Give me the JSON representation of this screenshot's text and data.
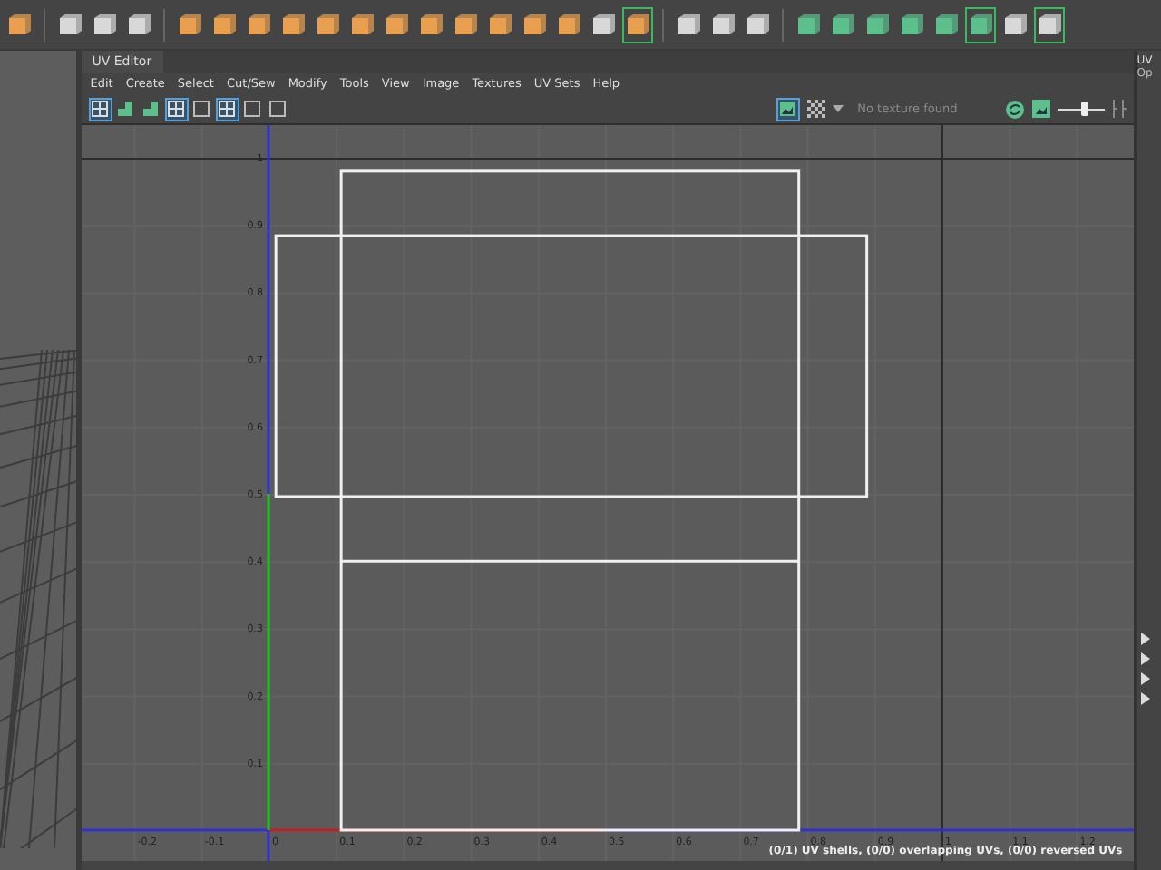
{
  "shelf": [
    {
      "kind": "orange",
      "selected": false
    },
    {
      "kind": "white",
      "selected": false
    },
    {
      "kind": "white",
      "selected": false
    },
    {
      "kind": "white",
      "selected": false
    },
    {
      "kind": "orange",
      "selected": false
    },
    {
      "kind": "orange",
      "selected": false
    },
    {
      "kind": "orange",
      "selected": false
    },
    {
      "kind": "orange",
      "selected": false
    },
    {
      "kind": "orange",
      "selected": false
    },
    {
      "kind": "orange",
      "selected": false
    },
    {
      "kind": "orange",
      "selected": false
    },
    {
      "kind": "orange",
      "selected": false
    },
    {
      "kind": "orange",
      "selected": false
    },
    {
      "kind": "orange",
      "selected": false
    },
    {
      "kind": "orange",
      "selected": false
    },
    {
      "kind": "orange",
      "selected": false
    },
    {
      "kind": "white",
      "selected": false
    },
    {
      "kind": "orange",
      "selected": true
    },
    {
      "kind": "white",
      "selected": false
    },
    {
      "kind": "white",
      "selected": false
    },
    {
      "kind": "white",
      "selected": false
    },
    {
      "kind": "green",
      "selected": false
    },
    {
      "kind": "green",
      "selected": false
    },
    {
      "kind": "green",
      "selected": false
    },
    {
      "kind": "green",
      "selected": false
    },
    {
      "kind": "green",
      "selected": false
    },
    {
      "kind": "green",
      "selected": true
    },
    {
      "kind": "white",
      "selected": false
    },
    {
      "kind": "white",
      "selected": true
    }
  ],
  "editor": {
    "title": "UV Editor",
    "menu": [
      "Edit",
      "Create",
      "Select",
      "Cut/Sew",
      "Modify",
      "Tools",
      "View",
      "Image",
      "Textures",
      "UV Sets",
      "Help"
    ],
    "tools": [
      {
        "kind": "grid",
        "selected": true
      },
      {
        "kind": "green",
        "selected": false
      },
      {
        "kind": "green",
        "selected": false
      },
      {
        "kind": "grid",
        "selected": true
      },
      {
        "kind": "grey",
        "selected": false
      },
      {
        "kind": "grid",
        "selected": true
      },
      {
        "kind": "grey",
        "selected": false
      },
      {
        "kind": "grey",
        "selected": false
      }
    ],
    "image_toggle": {
      "selected": true
    },
    "texture_label": "No texture found",
    "exposure": {
      "level": 0.6
    },
    "u_ticks": [
      "-0.2",
      "-0.1",
      "0",
      "0.1",
      "0.2",
      "0.3",
      "0.4",
      "0.5",
      "0.6",
      "0.7",
      "0.8",
      "0.9",
      "1",
      "1.1",
      "1.2"
    ],
    "v_ticks": [
      "1",
      "0.9",
      "0.8",
      "0.7",
      "0.6",
      "0.5",
      "0.4",
      "0.3",
      "0.2",
      "0.1"
    ],
    "status": "(0/1) UV shells, (0/0) overlapping UVs, (0/0) reversed UVs"
  },
  "side_panel": {
    "title": "UV",
    "subtitle": "Op"
  }
}
